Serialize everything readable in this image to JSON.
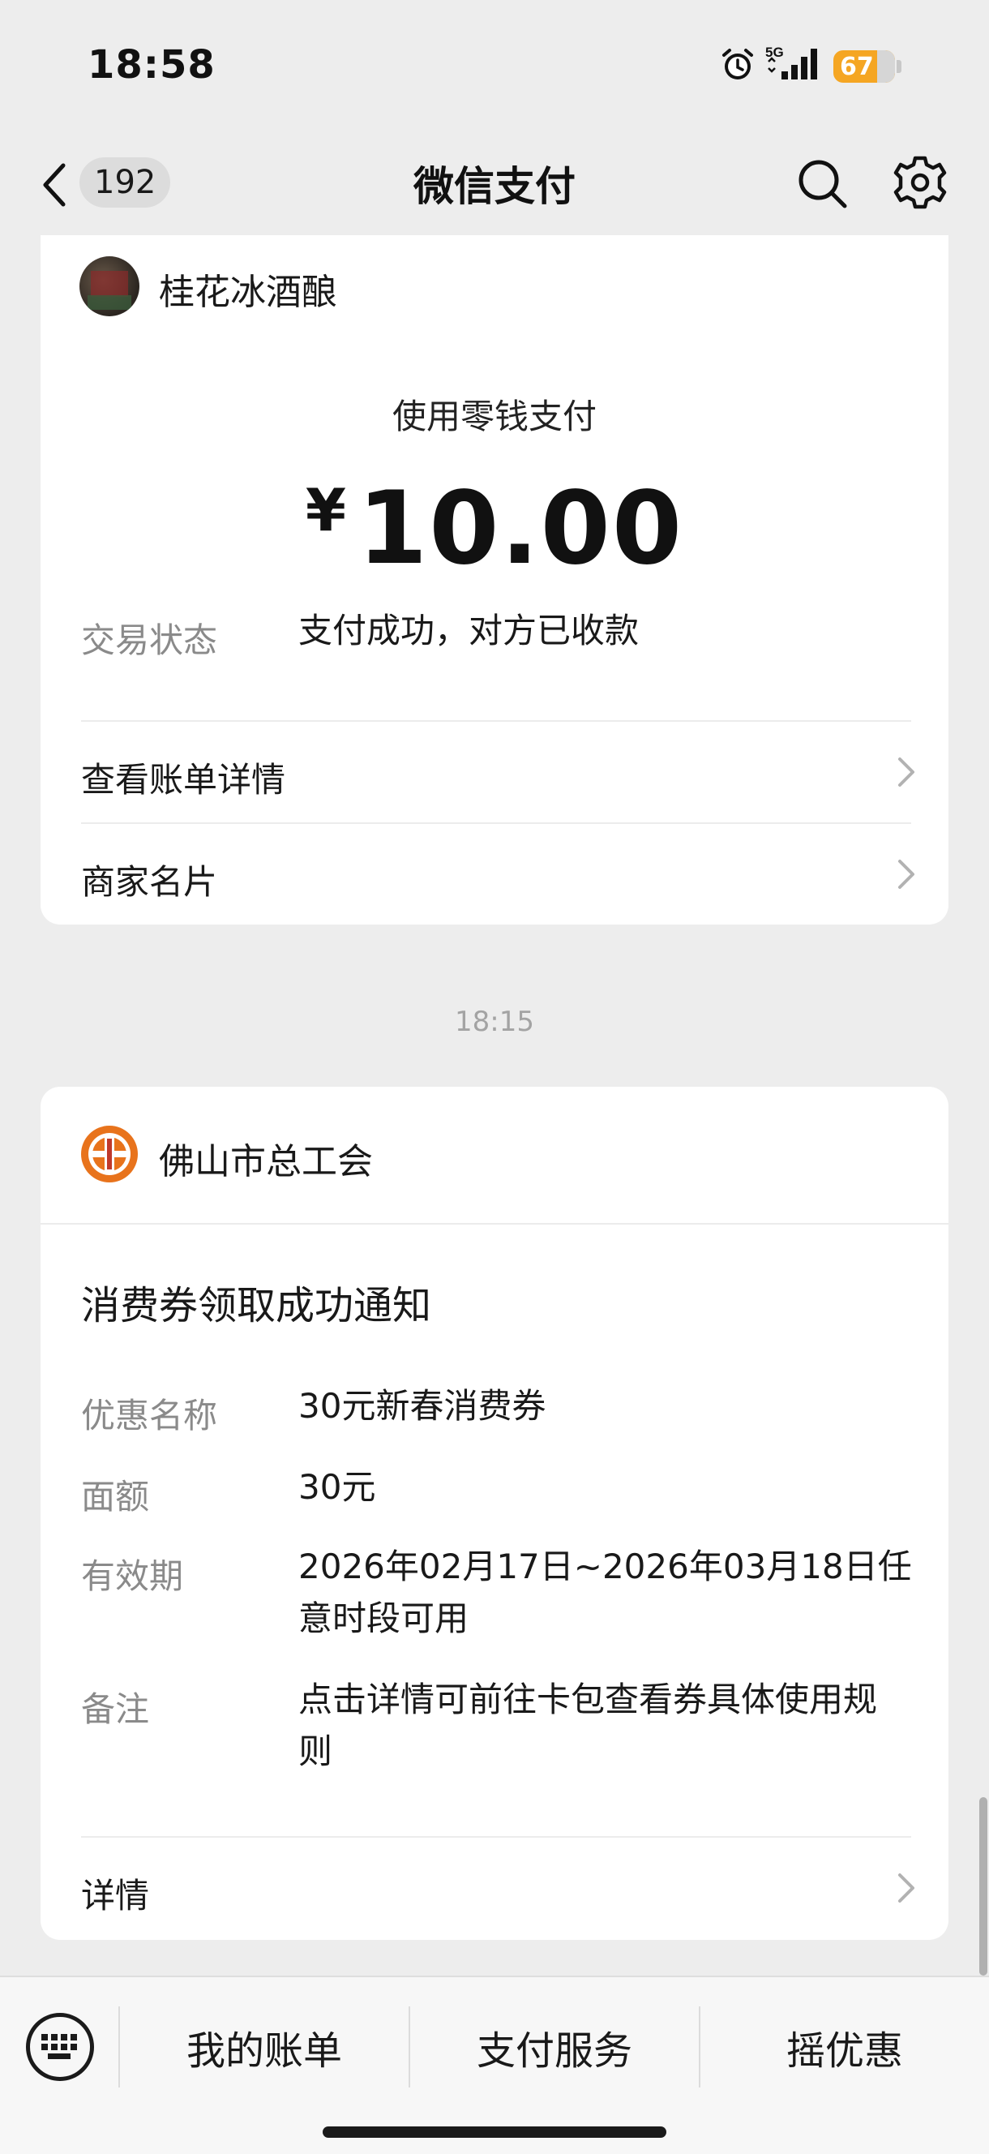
{
  "status_bar": {
    "time": "18:58",
    "network": "5G",
    "battery": "67",
    "icons": [
      "alarm-icon",
      "signal-icon",
      "battery-icon"
    ]
  },
  "nav": {
    "unread_count": "192",
    "title": "微信支付",
    "icons": [
      "back-icon",
      "search-icon",
      "settings-icon"
    ]
  },
  "payment_card": {
    "merchant": "桂花冰酒酿",
    "method": "使用零钱支付",
    "currency_symbol": "¥",
    "amount": "10.00",
    "status_label": "交易状态",
    "status_value": "支付成功，对方已收款",
    "links": [
      {
        "label": "查看账单详情"
      },
      {
        "label": "商家名片"
      }
    ]
  },
  "timestamp": "18:15",
  "notice_card": {
    "org": "佛山市总工会",
    "title": "消费券领取成功通知",
    "fields": [
      {
        "label": "优惠名称",
        "value": "30元新春消费券"
      },
      {
        "label": "面额",
        "value": "30元"
      },
      {
        "label": "有效期",
        "value": "2026年02月17日~2026年03月18日任意时段可用"
      },
      {
        "label": "备注",
        "value": "点击详情可前往卡包查看券具体使用规则"
      }
    ],
    "detail_link": "详情"
  },
  "bottom_menu": {
    "items": [
      "我的账单",
      "支付服务",
      "摇优惠"
    ],
    "keyboard_icon": "keyboard-icon"
  },
  "colors": {
    "background": "#ededed",
    "card": "#ffffff",
    "label_gray": "#8a8a8a",
    "battery": "#f5a623",
    "union_logo": "#e8731c"
  }
}
